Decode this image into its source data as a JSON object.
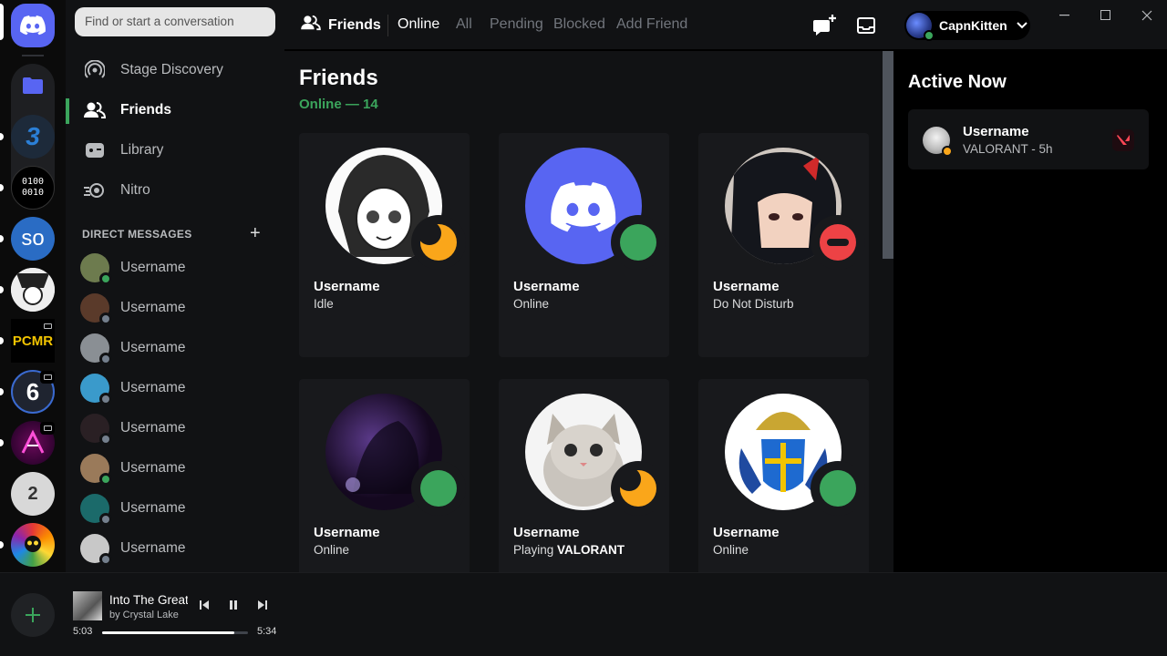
{
  "search": {
    "placeholder": "Find or start a conversation"
  },
  "nav": [
    {
      "label": "Stage Discovery",
      "icon": "stage-icon"
    },
    {
      "label": "Friends",
      "icon": "friends-icon",
      "active": true
    },
    {
      "label": "Library",
      "icon": "library-icon"
    },
    {
      "label": "Nitro",
      "icon": "nitro-icon"
    }
  ],
  "dm_section": {
    "title": "DIRECT MESSAGES"
  },
  "dms": [
    {
      "name": "Username",
      "status": "online",
      "color": "#6d7b4e"
    },
    {
      "name": "Username",
      "status": "offline",
      "color": "#5a3a2a"
    },
    {
      "name": "Username",
      "status": "offline",
      "color": "#8a8f94"
    },
    {
      "name": "Username",
      "status": "offline",
      "color": "#3a9acb"
    },
    {
      "name": "Username",
      "status": "offline",
      "color": "#2a2024"
    },
    {
      "name": "Username",
      "status": "online",
      "color": "#9a7a5a"
    },
    {
      "name": "Username",
      "status": "offline",
      "color": "#1b6a6a"
    },
    {
      "name": "Username",
      "status": "offline",
      "color": "#c8c8c8"
    }
  ],
  "topbar": {
    "title": "Friends",
    "tabs": [
      "Online",
      "All",
      "Pending",
      "Blocked",
      "Add Friend"
    ],
    "selected_tab": "Online",
    "account_name": "CapnKitten"
  },
  "main": {
    "title": "Friends",
    "subtitle": "Online — 14",
    "friends": [
      {
        "name": "Username",
        "status_text": "Idle",
        "status": "idle",
        "pic": "manga"
      },
      {
        "name": "Username",
        "status_text": "Online",
        "status": "online",
        "pic": "discord"
      },
      {
        "name": "Username",
        "status_text": "Do Not Disturb",
        "status": "dnd",
        "pic": "anime"
      },
      {
        "name": "Username",
        "status_text": "Online",
        "status": "online",
        "pic": "dark"
      },
      {
        "name": "Username",
        "status_prefix": "Playing",
        "status_game": "VALORANT",
        "status": "idle",
        "pic": "kitten"
      },
      {
        "name": "Username",
        "status_text": "Online",
        "status": "online",
        "pic": "crest"
      }
    ]
  },
  "active_now": {
    "title": "Active Now",
    "items": [
      {
        "name": "Username",
        "game": "VALORANT - 5h"
      }
    ]
  },
  "player": {
    "title": "Into The Great",
    "artist": "by Crystal Lake",
    "current": "5:03",
    "total": "5:34",
    "progress": 0.907
  },
  "server_badges": [
    "3",
    "0100 0010",
    "so",
    "PCMR",
    "6",
    "2"
  ],
  "colors": {
    "accent": "#5865f2",
    "online": "#3ba55c",
    "idle": "#faa61a",
    "dnd": "#ed4245",
    "offline": "#747f8d"
  }
}
